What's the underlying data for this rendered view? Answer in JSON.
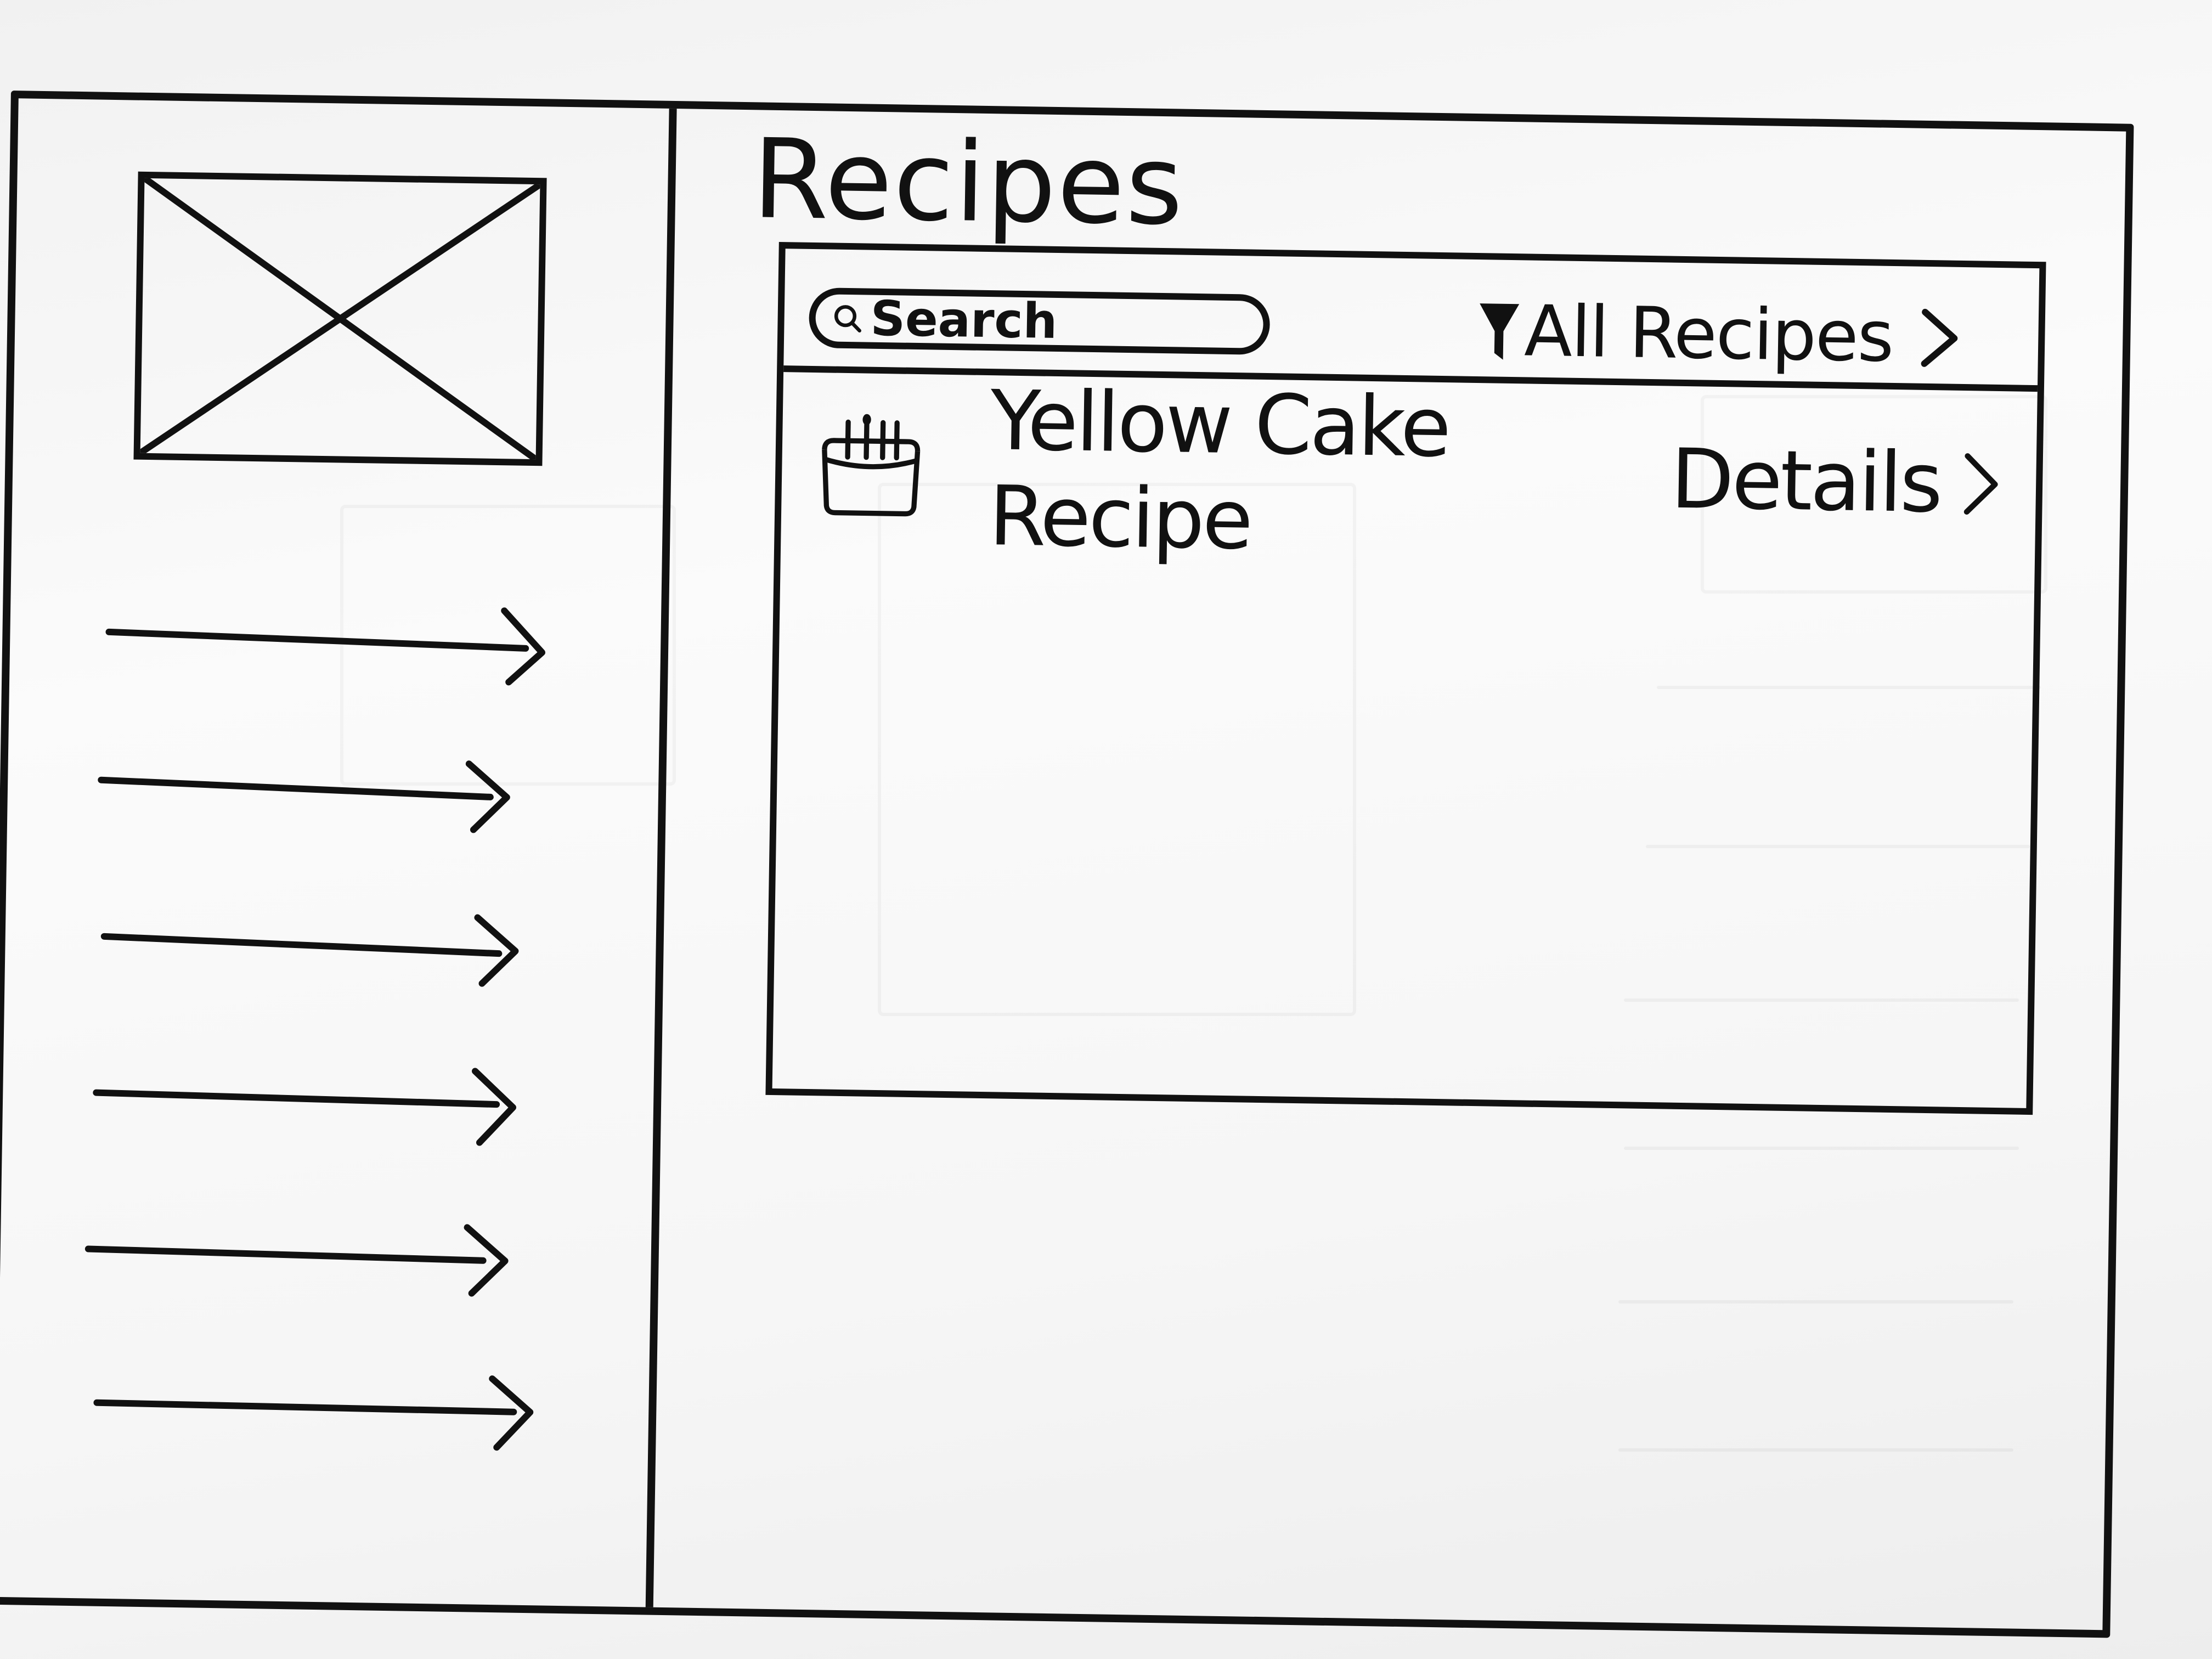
{
  "page": {
    "title": "Recipes"
  },
  "sidebar": {
    "logo": "image-placeholder",
    "items": [
      {
        "icon": "chevron-right-icon"
      },
      {
        "icon": "chevron-right-icon"
      },
      {
        "icon": "chevron-right-icon"
      },
      {
        "icon": "chevron-right-icon"
      },
      {
        "icon": "chevron-right-icon"
      },
      {
        "icon": "chevron-right-icon"
      }
    ]
  },
  "toolbar": {
    "search_placeholder": "Search",
    "search_icon": "search-icon",
    "filter_icon": "filter-icon",
    "filter_label": "All Recipes"
  },
  "recipes": [
    {
      "icon": "cake-icon",
      "name": "Yellow Cake Recipe",
      "link_label": "Details"
    }
  ],
  "colors": {
    "ink": "#111111",
    "paper": "#f8f8f8"
  }
}
